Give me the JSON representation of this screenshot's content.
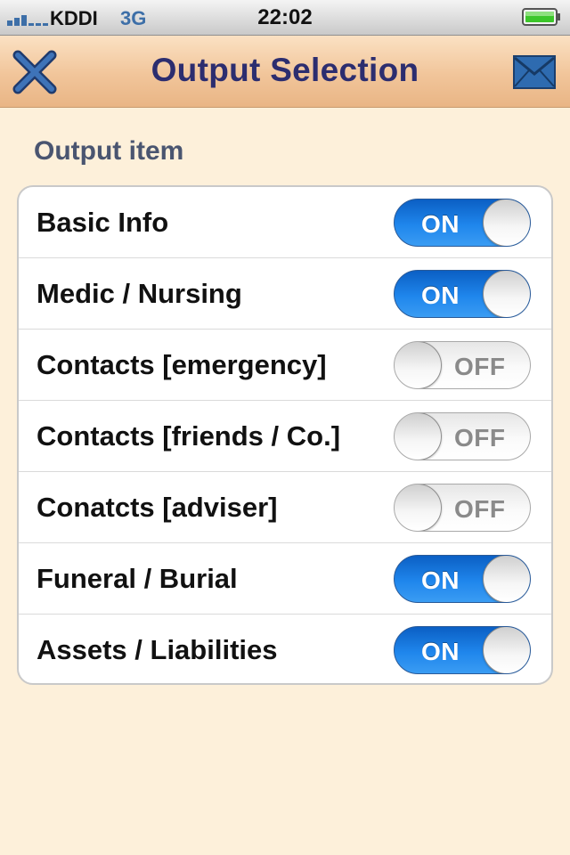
{
  "status_bar": {
    "carrier": "KDDI",
    "network": "3G",
    "time": "22:02",
    "signal_icon": "signal-bars-icon",
    "battery_icon": "battery-full-icon"
  },
  "nav": {
    "title": "Output Selection",
    "left_icon": "close-icon",
    "right_icon": "mail-icon"
  },
  "section": {
    "header": "Output item"
  },
  "items": [
    {
      "label": "Basic Info",
      "state": "ON"
    },
    {
      "label": "Medic / Nursing",
      "state": "ON"
    },
    {
      "label": "Contacts [emergency]",
      "state": "OFF"
    },
    {
      "label": "Contacts [friends / Co.]",
      "state": "OFF"
    },
    {
      "label": "Conatcts [adviser]",
      "state": "OFF"
    },
    {
      "label": "Funeral / Burial",
      "state": "ON"
    },
    {
      "label": "Assets / Liabilities",
      "state": "ON"
    }
  ],
  "colors": {
    "background": "#fdf0da",
    "nav_title": "#2c2d6f",
    "switch_on": "#1f86ec",
    "section_header": "#4a5570"
  }
}
